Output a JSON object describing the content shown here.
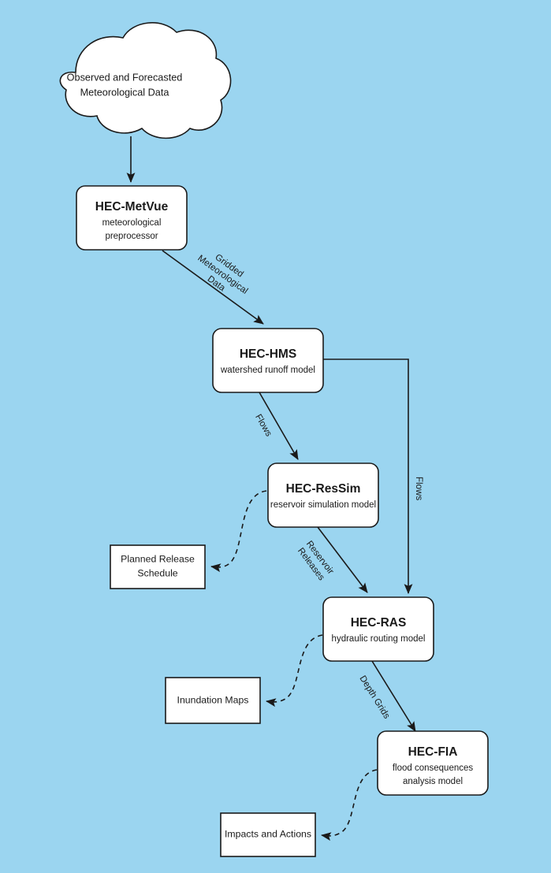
{
  "diagram": {
    "background_color": "#9bd5f0",
    "node_fill": "#ffffff",
    "stroke_color": "#1a1a1a",
    "source_node": {
      "shape": "cloud",
      "line1": "Observed and Forecasted",
      "line2": "Meteorological Data"
    },
    "process_nodes": [
      {
        "id": "hec-metvue",
        "title": "HEC-MetVue",
        "subtitle_line1": "meteorological",
        "subtitle_line2": "preprocessor"
      },
      {
        "id": "hec-hms",
        "title": "HEC-HMS",
        "subtitle_line1": "watershed runoff model",
        "subtitle_line2": ""
      },
      {
        "id": "hec-ressim",
        "title": "HEC-ResSim",
        "subtitle_line1": "reservoir simulation model",
        "subtitle_line2": ""
      },
      {
        "id": "hec-ras",
        "title": "HEC-RAS",
        "subtitle_line1": "hydraulic routing model",
        "subtitle_line2": ""
      },
      {
        "id": "hec-fia",
        "title": "HEC-FIA",
        "subtitle_line1": "flood consequences",
        "subtitle_line2": "analysis model"
      }
    ],
    "output_nodes": [
      {
        "id": "planned-release-schedule",
        "line1": "Planned Release",
        "line2": "Schedule"
      },
      {
        "id": "inundation-maps",
        "line1": "Inundation Maps",
        "line2": ""
      },
      {
        "id": "impacts-and-actions",
        "line1": "Impacts and Actions",
        "line2": ""
      }
    ],
    "edge_labels": {
      "gridded_met_data_l1": "Gridded",
      "gridded_met_data_l2": "Meteorological",
      "gridded_met_data_l3": "Data",
      "flows_left": "Flows",
      "flows_right": "Flows",
      "reservoir_releases_l1": "Reservoir",
      "reservoir_releases_l2": "Releases",
      "depth_grids": "Depth Grids"
    }
  }
}
